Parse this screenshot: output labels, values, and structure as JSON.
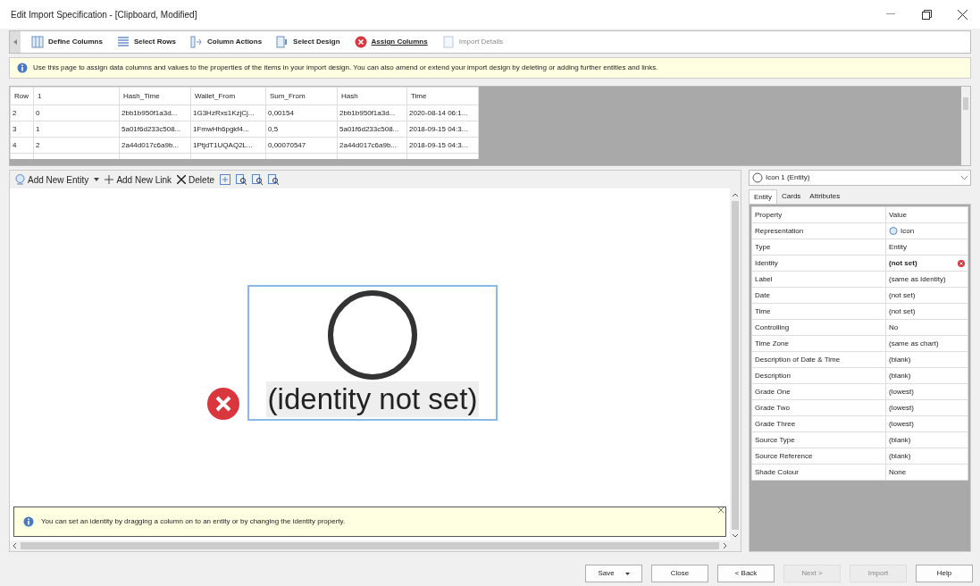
{
  "window": {
    "title": "Edit Import Specification - [Clipboard, Modified]"
  },
  "steps": [
    {
      "label": "Define Columns",
      "selected": false,
      "disabled": false
    },
    {
      "label": "Select Rows",
      "selected": false,
      "disabled": false
    },
    {
      "label": "Column Actions",
      "selected": false,
      "disabled": false
    },
    {
      "label": "Select Design",
      "selected": false,
      "disabled": false
    },
    {
      "label": "Assign Columns",
      "selected": true,
      "disabled": false,
      "error": true
    },
    {
      "label": "Import Details",
      "selected": false,
      "disabled": true
    }
  ],
  "info": "Use this page to assign data columns and values to the properties of the items in your import design. You can also amend or extend your import design by deleting or adding further entities and links.",
  "table": {
    "columns": [
      "Row",
      "1",
      "Hash_Time",
      "Wallet_From",
      "Sum_From",
      "Hash",
      "Time"
    ],
    "rows": [
      [
        "2",
        "0",
        "2bb1b950f1a3d...",
        "1G3HzRxs1KzjCj...",
        "0,00154",
        "2bb1b950f1a3d...",
        "2020-08-14 06:1..."
      ],
      [
        "3",
        "1",
        "5a01f6d233c508...",
        "1FmwHh6pgkf4...",
        "0,5",
        "5a01f6d233c508...",
        "2018-09-15 04:3..."
      ],
      [
        "4",
        "2",
        "2a44d017c6a9b...",
        "1PtjdT1UQAQ2L...",
        "0,00070547",
        "2a44d017c6a9b...",
        "2018-09-15 04:3..."
      ]
    ]
  },
  "chart_toolbar": {
    "add_entity": "Add New Entity",
    "add_link": "Add New Link",
    "delete": "Delete"
  },
  "entity": {
    "label": "(identity not set)",
    "error": true
  },
  "hint": "You can set an identity by dragging a column on to an entity or by changing the identity property.",
  "inspector": {
    "selector": "Icon 1 (Entity)",
    "tabs": [
      {
        "label": "Entity",
        "selected": true
      },
      {
        "label": "Cards",
        "selected": false
      },
      {
        "label": "Attributes",
        "selected": false
      }
    ],
    "columns": [
      "Property",
      "Value"
    ],
    "properties": [
      {
        "name": "Representation",
        "value": "Icon",
        "icon": true,
        "bold": false,
        "error": false
      },
      {
        "name": "Type",
        "value": "Entity",
        "icon": false,
        "bold": false,
        "error": false
      },
      {
        "name": "Identity",
        "value": "(not set)",
        "icon": false,
        "bold": true,
        "error": true
      },
      {
        "name": "Label",
        "value": "(same as Identity)",
        "icon": false,
        "bold": false,
        "error": false
      },
      {
        "name": "Date",
        "value": "(not set)",
        "icon": false,
        "bold": false,
        "error": false
      },
      {
        "name": "Time",
        "value": "(not set)",
        "icon": false,
        "bold": false,
        "error": false
      },
      {
        "name": "Controlling",
        "value": "No",
        "icon": false,
        "bold": false,
        "error": false
      },
      {
        "name": "Time Zone",
        "value": "(same as chart)",
        "icon": false,
        "bold": false,
        "error": false
      },
      {
        "name": "Description of Date & Time",
        "value": "(blank)",
        "icon": false,
        "bold": false,
        "error": false
      },
      {
        "name": "Description",
        "value": "(blank)",
        "icon": false,
        "bold": false,
        "error": false
      },
      {
        "name": "Grade One",
        "value": "(lowest)",
        "icon": false,
        "bold": false,
        "error": false
      },
      {
        "name": "Grade Two",
        "value": "(lowest)",
        "icon": false,
        "bold": false,
        "error": false
      },
      {
        "name": "Grade Three",
        "value": "(lowest)",
        "icon": false,
        "bold": false,
        "error": false
      },
      {
        "name": "Source Type",
        "value": "(blank)",
        "icon": false,
        "bold": false,
        "error": false
      },
      {
        "name": "Source Reference",
        "value": "(blank)",
        "icon": false,
        "bold": false,
        "error": false
      },
      {
        "name": "Shade Colour",
        "value": "None",
        "icon": false,
        "bold": false,
        "error": false
      }
    ]
  },
  "buttons": [
    {
      "label": "Save",
      "dropdown": true,
      "disabled": false
    },
    {
      "label": "Close",
      "dropdown": false,
      "disabled": false
    },
    {
      "label": "< Back",
      "dropdown": false,
      "disabled": false
    },
    {
      "label": "Next >",
      "dropdown": false,
      "disabled": true
    },
    {
      "label": "Import",
      "dropdown": false,
      "disabled": true
    },
    {
      "label": "Help",
      "dropdown": false,
      "disabled": false
    }
  ]
}
